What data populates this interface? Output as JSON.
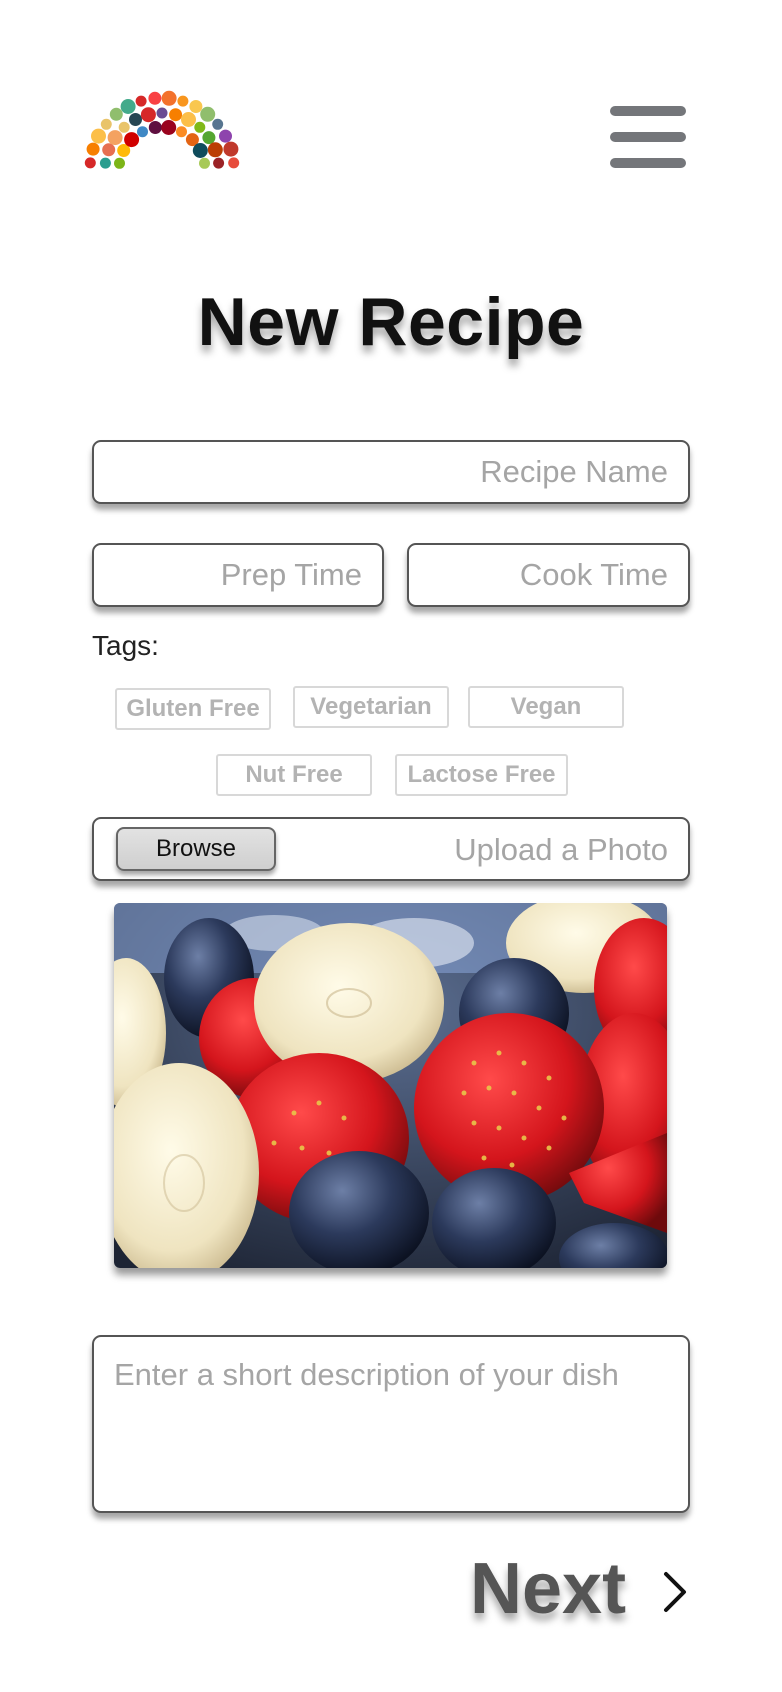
{
  "header": {
    "logo_icon": "fruit-rainbow-logo-icon",
    "menu_icon": "hamburger-menu-icon"
  },
  "page": {
    "title": "New Recipe"
  },
  "form": {
    "recipe_name_placeholder": "Recipe Name",
    "prep_time_placeholder": "Prep Time",
    "cook_time_placeholder": "Cook Time",
    "tags_label": "Tags:",
    "tags": [
      "Gluten Free",
      "Vegetarian",
      "Vegan",
      "Nut Free",
      "Lactose Free"
    ],
    "browse_label": "Browse",
    "upload_label": "Upload a Photo",
    "photo_alt": "fruit-photo",
    "description_placeholder": "Enter a short description of your dish",
    "next_label": "Next",
    "next_icon": "chevron-right-icon"
  },
  "colors": {
    "border": "#555555",
    "placeholder": "#a5a5a5",
    "tag_border": "#d8d8d8",
    "tag_text": "#b3b3b3",
    "menu_icon": "#74767a"
  }
}
